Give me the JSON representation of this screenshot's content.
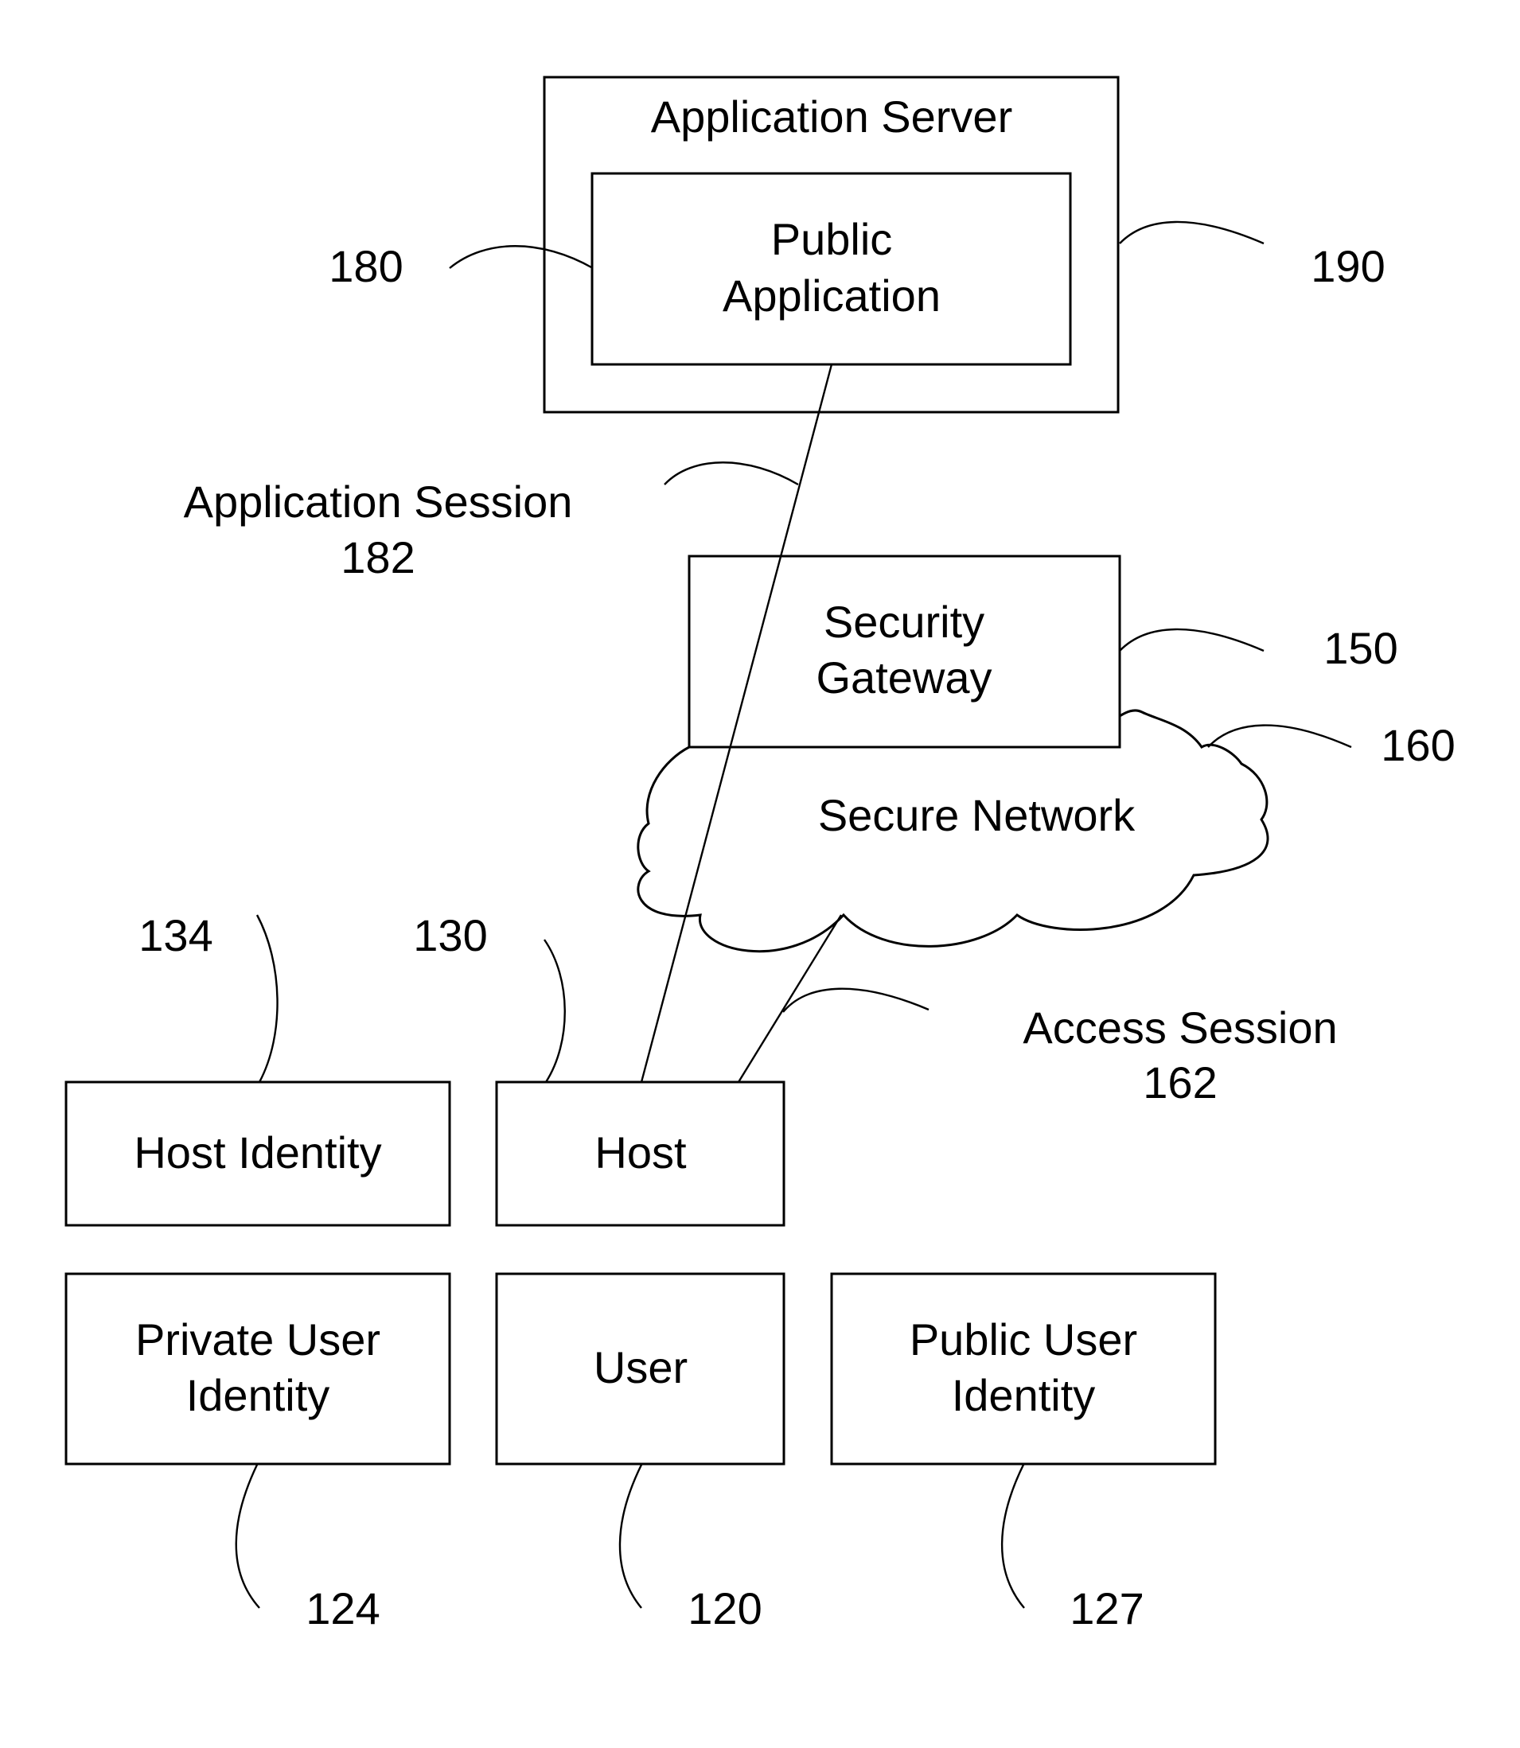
{
  "diagram": {
    "type": "network-architecture-figure",
    "nodes": {
      "application_server": {
        "label": "Application Server",
        "ref": "190"
      },
      "public_application": {
        "label_lines": [
          "Public",
          "Application"
        ],
        "ref": "180"
      },
      "security_gateway": {
        "label_lines": [
          "Security",
          "Gateway"
        ],
        "ref": "150"
      },
      "secure_network": {
        "label": "Secure Network",
        "ref": "160"
      },
      "host_identity": {
        "label": "Host Identity",
        "ref": "134"
      },
      "host": {
        "label": "Host",
        "ref": "130"
      },
      "private_user_identity": {
        "label_lines": [
          "Private User",
          "Identity"
        ],
        "ref": "124"
      },
      "user": {
        "label": "User",
        "ref": "120"
      },
      "public_user_identity": {
        "label_lines": [
          "Public User",
          "Identity"
        ],
        "ref": "127"
      }
    },
    "connections": {
      "application_session": {
        "label": "Application Session",
        "ref": "182",
        "from": "host",
        "to": "public_application"
      },
      "access_session": {
        "label": "Access Session",
        "ref": "162",
        "from": "host",
        "to": "secure_network"
      }
    }
  },
  "colors": {
    "stroke": "#000000",
    "background": "#ffffff"
  }
}
